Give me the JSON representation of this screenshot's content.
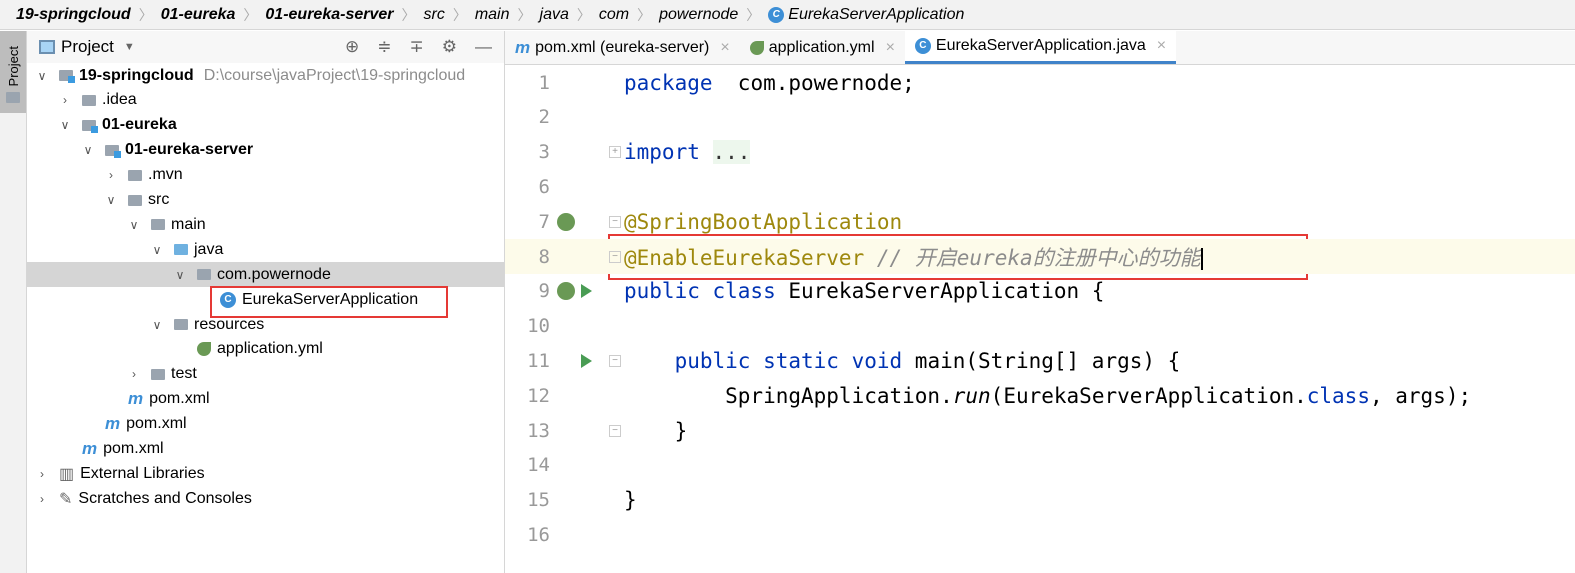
{
  "breadcrumb": [
    {
      "label": "19-springcloud",
      "bold": true
    },
    {
      "label": "01-eureka",
      "bold": true
    },
    {
      "label": "01-eureka-server",
      "bold": true
    },
    {
      "label": "src"
    },
    {
      "label": "main"
    },
    {
      "label": "java"
    },
    {
      "label": "com"
    },
    {
      "label": "powernode"
    },
    {
      "label": "EurekaServerApplication",
      "icon": "class-icon"
    }
  ],
  "sidebar_tab": "Project",
  "project_panel": {
    "title": "Project",
    "tools": [
      "locate-icon",
      "expand-all-icon",
      "collapse-all-icon",
      "gear-icon",
      "minimize-icon"
    ]
  },
  "tree": [
    {
      "label": "19-springcloud",
      "hint": "D:\\course\\javaProject\\19-springcloud",
      "depth": 0,
      "arrow": "down",
      "icon": "module-folder",
      "bold": true
    },
    {
      "label": ".idea",
      "depth": 1,
      "arrow": "right",
      "icon": "folder"
    },
    {
      "label": "01-eureka",
      "depth": 1,
      "arrow": "down",
      "icon": "module-folder",
      "bold": true
    },
    {
      "label": "01-eureka-server",
      "depth": 2,
      "arrow": "down",
      "icon": "module-folder",
      "bold": true
    },
    {
      "label": ".mvn",
      "depth": 3,
      "arrow": "right",
      "icon": "folder"
    },
    {
      "label": "src",
      "depth": 3,
      "arrow": "down",
      "icon": "folder"
    },
    {
      "label": "main",
      "depth": 4,
      "arrow": "down",
      "icon": "folder"
    },
    {
      "label": "java",
      "depth": 5,
      "arrow": "down",
      "icon": "source-folder"
    },
    {
      "label": "com.powernode",
      "depth": 6,
      "arrow": "down",
      "icon": "package",
      "selected": true
    },
    {
      "label": "EurekaServerApplication",
      "depth": 7,
      "icon": "class-icon",
      "highlighted": true
    },
    {
      "label": "resources",
      "depth": 5,
      "arrow": "down",
      "icon": "resources-folder"
    },
    {
      "label": "application.yml",
      "depth": 6,
      "icon": "spring-yml"
    },
    {
      "label": "test",
      "depth": 4,
      "arrow": "right",
      "icon": "folder"
    },
    {
      "label": "pom.xml",
      "depth": 3,
      "icon": "maven"
    },
    {
      "label": "pom.xml",
      "depth": 2,
      "icon": "maven"
    },
    {
      "label": "pom.xml",
      "depth": 1,
      "icon": "maven"
    },
    {
      "label": "External Libraries",
      "depth": 0,
      "arrow": "right",
      "icon": "libraries"
    },
    {
      "label": "Scratches and Consoles",
      "depth": 0,
      "arrow": "right",
      "icon": "scratches"
    }
  ],
  "tabs": [
    {
      "label": "pom.xml (eureka-server)",
      "icon": "maven"
    },
    {
      "label": "application.yml",
      "icon": "spring-yml"
    },
    {
      "label": "EurekaServerApplication.java",
      "icon": "class-icon",
      "active": true
    }
  ],
  "editor": {
    "lines": [
      {
        "n": "1",
        "parts": [
          [
            "kw",
            "package"
          ],
          [
            "",
            "  com.powernode;"
          ]
        ]
      },
      {
        "n": "2",
        "parts": []
      },
      {
        "n": "3",
        "parts": [
          [
            "kw",
            "import"
          ],
          [
            "",
            " "
          ],
          [
            "fold",
            "..."
          ]
        ],
        "fold": true
      },
      {
        "n": "6",
        "parts": []
      },
      {
        "n": "7",
        "parts": [
          [
            "an",
            "@SpringBootApplication"
          ]
        ],
        "fold": true,
        "gutter": "spring-bean-icon"
      },
      {
        "n": "8",
        "parts": [
          [
            "an",
            "@EnableEurekaServer"
          ],
          [
            "cm",
            " // 开启eureka的注册中心的功能"
          ]
        ],
        "current": true,
        "fold": true
      },
      {
        "n": "9",
        "parts": [
          [
            "kw",
            "public class"
          ],
          [
            "",
            " EurekaServerApplication {"
          ]
        ],
        "gutter": "spring-bean-icon",
        "run": true
      },
      {
        "n": "10",
        "parts": []
      },
      {
        "n": "11",
        "parts": [
          [
            "",
            "    "
          ],
          [
            "kw",
            "public static void"
          ],
          [
            "",
            " main(String[] args) {"
          ]
        ],
        "run": true,
        "fold": true
      },
      {
        "n": "12",
        "parts": [
          [
            "",
            "        SpringApplication."
          ],
          [
            "it",
            "run"
          ],
          [
            "",
            "(EurekaServerApplication."
          ],
          [
            "kw",
            "class"
          ],
          [
            "",
            ", args);"
          ]
        ]
      },
      {
        "n": "13",
        "parts": [
          [
            "",
            "    }"
          ]
        ],
        "fold": true
      },
      {
        "n": "14",
        "parts": []
      },
      {
        "n": "15",
        "parts": [
          [
            "",
            "}"
          ]
        ]
      },
      {
        "n": "16",
        "parts": []
      }
    ]
  },
  "colors": {
    "keyword": "#0033b3",
    "annotation": "#9e880d",
    "comment": "#8c8c8c",
    "highlight_box": "#e53935",
    "active_tab": "#4083c9"
  }
}
